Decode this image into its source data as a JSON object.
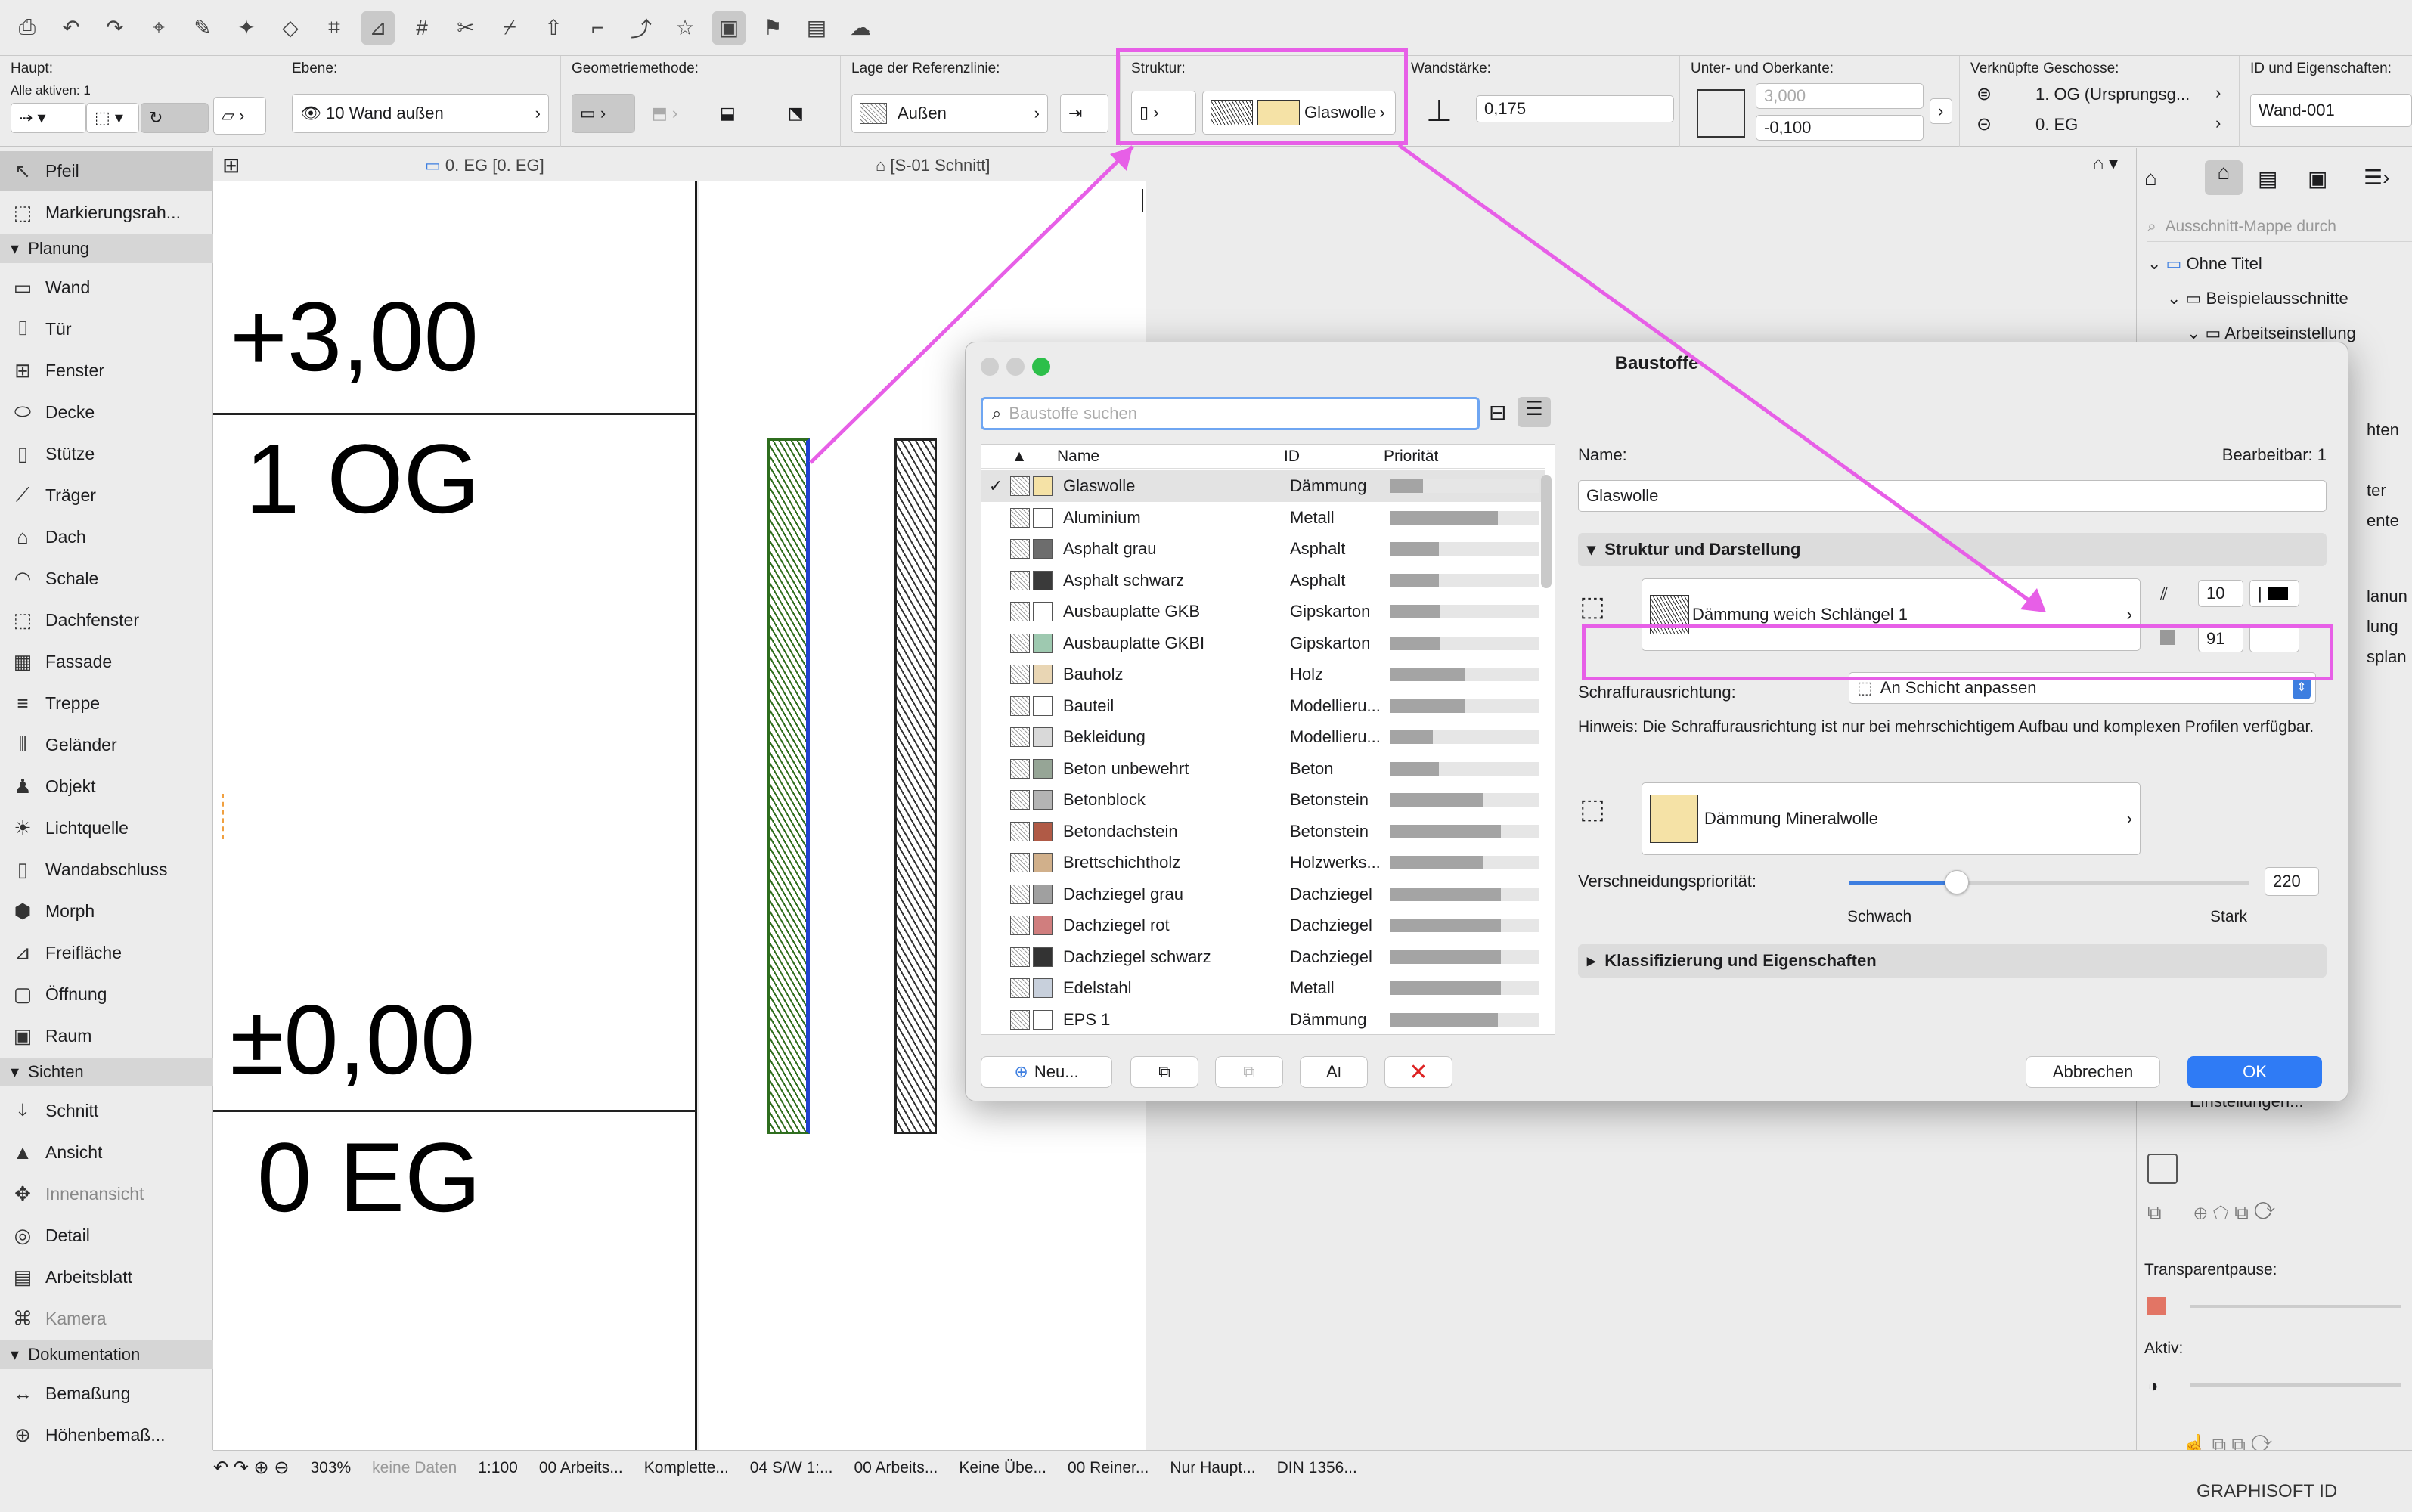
{
  "toolbar": {
    "icons": [
      "save-icon",
      "undo-icon",
      "redo-icon",
      "pick-up-icon",
      "inject-icon",
      "magic-wand-icon",
      "select-icon",
      "snap-icon",
      "guide-icon",
      "grid-icon",
      "trim-icon",
      "split-icon",
      "offset-icon",
      "fillet-icon",
      "elevate-icon",
      "favorites-icon",
      "layer-icon",
      "flag-icon",
      "trace-icon",
      "render-icon"
    ]
  },
  "infobox": {
    "haupt": {
      "label": "Haupt:",
      "sub": "Alle aktiven: 1"
    },
    "ebene": {
      "label": "Ebene:",
      "value": "10 Wand außen"
    },
    "geometrie": {
      "label": "Geometriemethode:"
    },
    "referenz": {
      "label": "Lage der Referenzlinie:",
      "value": "Außen"
    },
    "struktur": {
      "label": "Struktur:",
      "value": "Glaswolle"
    },
    "wandstaerke": {
      "label": "Wandstärke:",
      "value": "0,175"
    },
    "kanten": {
      "label": "Unter- und Oberkante:",
      "top": "3,000",
      "bottom": "-0,100"
    },
    "geschosse": {
      "label": "Verknüpfte Geschosse:",
      "top": "1. OG (Ursprungsg...",
      "bottom": "0. EG"
    },
    "id": {
      "label": "ID und Eigenschaften:",
      "value": "Wand-001"
    }
  },
  "tabs": {
    "left": "0. EG [0. EG]",
    "right": "[S-01 Schnitt]"
  },
  "sidebar": {
    "top": [
      {
        "label": "Pfeil",
        "icon": "arrow-icon"
      },
      {
        "label": "Markierungsrah...",
        "icon": "marquee-icon"
      }
    ],
    "planung_header": "Planung",
    "planung": [
      {
        "label": "Wand",
        "icon": "wall-icon"
      },
      {
        "label": "Tür",
        "icon": "door-icon"
      },
      {
        "label": "Fenster",
        "icon": "window-icon"
      },
      {
        "label": "Decke",
        "icon": "slab-icon"
      },
      {
        "label": "Stütze",
        "icon": "column-icon"
      },
      {
        "label": "Träger",
        "icon": "beam-icon"
      },
      {
        "label": "Dach",
        "icon": "roof-icon"
      },
      {
        "label": "Schale",
        "icon": "shell-icon"
      },
      {
        "label": "Dachfenster",
        "icon": "skylight-icon"
      },
      {
        "label": "Fassade",
        "icon": "curtain-wall-icon"
      },
      {
        "label": "Treppe",
        "icon": "stair-icon"
      },
      {
        "label": "Geländer",
        "icon": "railing-icon"
      },
      {
        "label": "Objekt",
        "icon": "object-icon"
      },
      {
        "label": "Lichtquelle",
        "icon": "lamp-icon"
      },
      {
        "label": "Wandabschluss",
        "icon": "wall-end-icon"
      },
      {
        "label": "Morph",
        "icon": "morph-icon"
      },
      {
        "label": "Freifläche",
        "icon": "mesh-icon"
      },
      {
        "label": "Öffnung",
        "icon": "opening-icon"
      },
      {
        "label": "Raum",
        "icon": "zone-icon"
      }
    ],
    "sichten_header": "Sichten",
    "sichten": [
      {
        "label": "Schnitt",
        "icon": "section-icon"
      },
      {
        "label": "Ansicht",
        "icon": "elevation-icon"
      },
      {
        "label": "Innenansicht",
        "icon": "interior-elevation-icon"
      },
      {
        "label": "Detail",
        "icon": "detail-icon"
      },
      {
        "label": "Arbeitsblatt",
        "icon": "worksheet-icon"
      },
      {
        "label": "Kamera",
        "icon": "camera-icon"
      }
    ],
    "doku_header": "Dokumentation",
    "doku": [
      {
        "label": "Bemaßung",
        "icon": "dimension-icon"
      },
      {
        "label": "Höhenbemaß...",
        "icon": "level-dimension-icon"
      }
    ]
  },
  "canvas": {
    "level_top": "+3,00",
    "story_top": "1 OG",
    "level_bottom": "±0,00",
    "story_bottom": "0 EG"
  },
  "dialog": {
    "title": "Baustoffe",
    "search_placeholder": "Baustoffe suchen",
    "columns": [
      "Name",
      "ID",
      "Priorität"
    ],
    "rows": [
      {
        "name": "Glaswolle",
        "id": "Dämmung",
        "prio": 0.22,
        "color": "#f5e2a6",
        "checked": true
      },
      {
        "name": "Aluminium",
        "id": "Metall",
        "prio": 0.72,
        "color": "#ffffff"
      },
      {
        "name": "Asphalt grau",
        "id": "Asphalt",
        "prio": 0.33,
        "color": "#6d6d6d"
      },
      {
        "name": "Asphalt schwarz",
        "id": "Asphalt",
        "prio": 0.33,
        "color": "#3a3a3a"
      },
      {
        "name": "Ausbauplatte GKB",
        "id": "Gipskarton",
        "prio": 0.34,
        "color": "#ffffff"
      },
      {
        "name": "Ausbauplatte GKBI",
        "id": "Gipskarton",
        "prio": 0.34,
        "color": "#9ec9b0"
      },
      {
        "name": "Bauholz",
        "id": "Holz",
        "prio": 0.5,
        "color": "#e9d6b4"
      },
      {
        "name": "Bauteil",
        "id": "Modellieru...",
        "prio": 0.5,
        "color": "#ffffff"
      },
      {
        "name": "Bekleidung",
        "id": "Modellieru...",
        "prio": 0.29,
        "color": "#d9d9d9"
      },
      {
        "name": "Beton unbewehrt",
        "id": "Beton",
        "prio": 0.33,
        "color": "#96a596"
      },
      {
        "name": "Betonblock",
        "id": "Betonstein",
        "prio": 0.62,
        "color": "#b4b4b4"
      },
      {
        "name": "Betondachstein",
        "id": "Betonstein",
        "prio": 0.74,
        "color": "#b05a46"
      },
      {
        "name": "Brettschichtholz",
        "id": "Holzwerks...",
        "prio": 0.62,
        "color": "#d1b08b"
      },
      {
        "name": "Dachziegel grau",
        "id": "Dachziegel",
        "prio": 0.74,
        "color": "#a0a0a0"
      },
      {
        "name": "Dachziegel rot",
        "id": "Dachziegel",
        "prio": 0.74,
        "color": "#d07e7e"
      },
      {
        "name": "Dachziegel schwarz",
        "id": "Dachziegel",
        "prio": 0.74,
        "color": "#333333"
      },
      {
        "name": "Edelstahl",
        "id": "Metall",
        "prio": 0.74,
        "color": "#c8d0dc"
      },
      {
        "name": "EPS 1",
        "id": "Dämmung",
        "prio": 0.72,
        "color": "#ffffff"
      }
    ],
    "buttons": {
      "new": "Neu...",
      "cancel": "Abbrechen",
      "ok": "OK"
    },
    "name_label": "Name:",
    "editable": "Bearbeitbar: 1",
    "name_value": "Glaswolle",
    "section1": "Struktur und Darstellung",
    "fill": "Dämmung weich Schlängel 1",
    "pen1": "10",
    "pen2": "91",
    "hatch_label": "Schraffurausrichtung:",
    "hatch_value": "An Schicht anpassen",
    "hint": "Hinweis: Die Schraffurausrichtung ist nur bei mehrschichtigem Aufbau und komplexen Profilen verfügbar.",
    "surface": "Dämmung Mineralwolle",
    "prio_label": "Verschneidungspriorität:",
    "prio_value": "220",
    "prio_fraction": 0.27,
    "weak": "Schwach",
    "strong": "Stark",
    "section2": "Klassifizierung und Eigenschaften"
  },
  "rightpanel": {
    "search_placeholder": "Ausschnitt-Mappe durch",
    "tree": [
      "Ohne Titel",
      "Beispielausschnitte",
      "Arbeitseinstellung"
    ],
    "partials": [
      "hten",
      "ter",
      "ente",
      "lanun",
      "lung",
      "splan"
    ],
    "settings": "Einstellungen...",
    "transparent": "Transparentpause:",
    "aktiv": "Aktiv:"
  },
  "status": {
    "zoom": "303%",
    "nodata": "keine Daten",
    "scale": "1:100",
    "items": [
      "00 Arbeits...",
      "Komplette...",
      "04 S/W 1:...",
      "00 Arbeits...",
      "Keine Übe...",
      "00 Reiner...",
      "Nur Haupt...",
      "DIN 1356..."
    ]
  },
  "brand": "GRAPHISOFT ID",
  "highlight_color": "#e75fe7"
}
